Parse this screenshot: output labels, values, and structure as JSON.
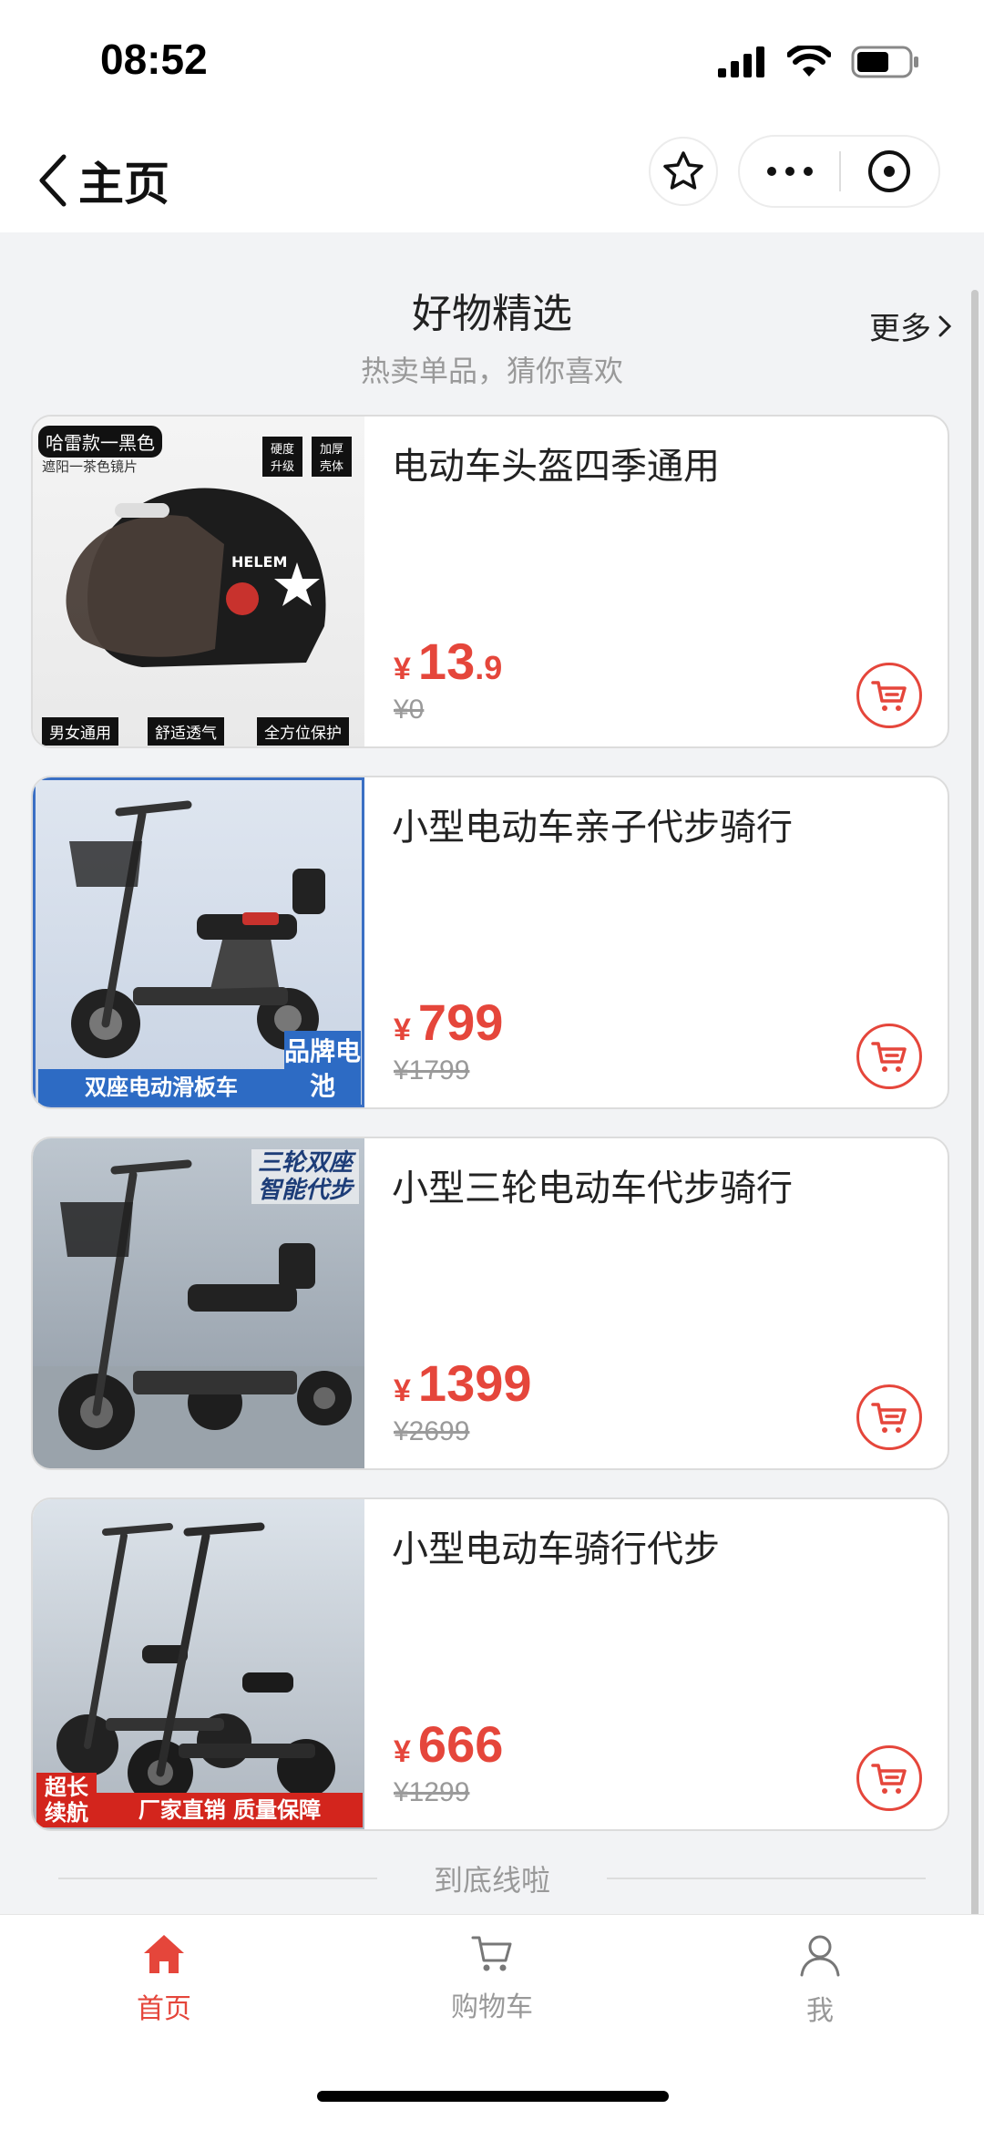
{
  "status_bar": {
    "time": "08:52"
  },
  "nav": {
    "title": "主页"
  },
  "section": {
    "title": "好物精选",
    "subtitle": "热卖单品，猜你喜欢",
    "more_label": "更多"
  },
  "products": [
    {
      "name": "电动车头盔四季通用",
      "price_int": "13",
      "price_dec": ".9",
      "original_price": "¥0",
      "image_labels": {
        "top_left": "哈雷款一黑色",
        "top_left_sub": "遮阳一茶色镜片",
        "badge1": "硬度升级",
        "badge2": "加厚壳体",
        "bottom1": "男女通用",
        "bottom2": "舒适透气",
        "bottom3": "全方位保护",
        "brand": "HELEM"
      }
    },
    {
      "name": "小型电动车亲子代步骑行",
      "price_int": "799",
      "price_dec": "",
      "original_price": "¥1799",
      "image_labels": {
        "bottom": "双座电动滑板车",
        "corner": "品牌电池"
      }
    },
    {
      "name": "小型三轮电动车代步骑行",
      "price_int": "1399",
      "price_dec": "",
      "original_price": "¥2699",
      "image_labels": {
        "top_right": "三轮双座智能代步"
      }
    },
    {
      "name": "小型电动车骑行代步",
      "price_int": "666",
      "price_dec": "",
      "original_price": "¥1299",
      "image_labels": {
        "corner": "超长续航",
        "bottom": "厂家直销 质量保障"
      }
    }
  ],
  "currency_symbol": "¥",
  "end_text": "到底线啦",
  "tabs": [
    {
      "label": "首页",
      "icon": "home-icon",
      "active": true
    },
    {
      "label": "购物车",
      "icon": "cart-icon",
      "active": false
    },
    {
      "label": "我",
      "icon": "user-icon",
      "active": false
    }
  ],
  "colors": {
    "accent": "#e5463b",
    "tab_inactive": "#999999"
  }
}
